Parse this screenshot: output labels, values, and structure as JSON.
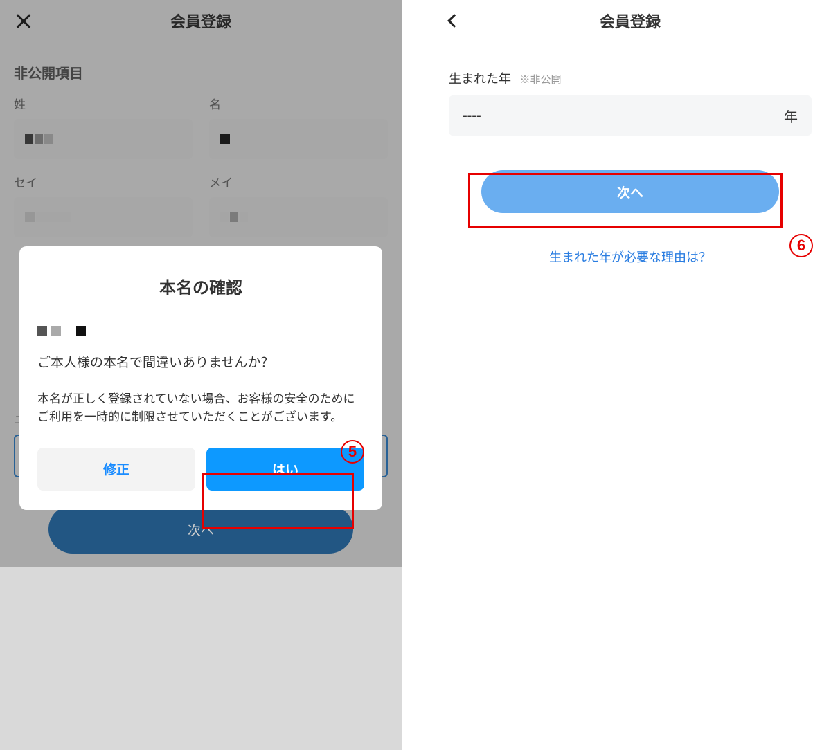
{
  "left": {
    "header": {
      "title": "会員登録"
    },
    "section_title": "非公開項目",
    "labels": {
      "sei_kanji": "姓",
      "mei_kanji": "名",
      "sei_kana": "セイ",
      "mei_kana": "メイ",
      "username": "ユーザー名"
    },
    "next_button": "次へ",
    "modal": {
      "title": "本名の確認",
      "question": "ご本人様の本名で間違いありませんか？",
      "description": "本名が正しく登録されていない場合、お客様の安全のためにご利用を一時的に制限させていただくことがございます。",
      "secondary": "修正",
      "primary": "はい"
    }
  },
  "right": {
    "header": {
      "title": "会員登録"
    },
    "birth": {
      "label": "生まれた年",
      "hint": "※非公開",
      "value": "----",
      "unit": "年"
    },
    "next_button": "次へ",
    "reason_link": "生まれた年が必要な理由は？"
  },
  "annotations": {
    "circ5": "5",
    "circ6": "6"
  }
}
